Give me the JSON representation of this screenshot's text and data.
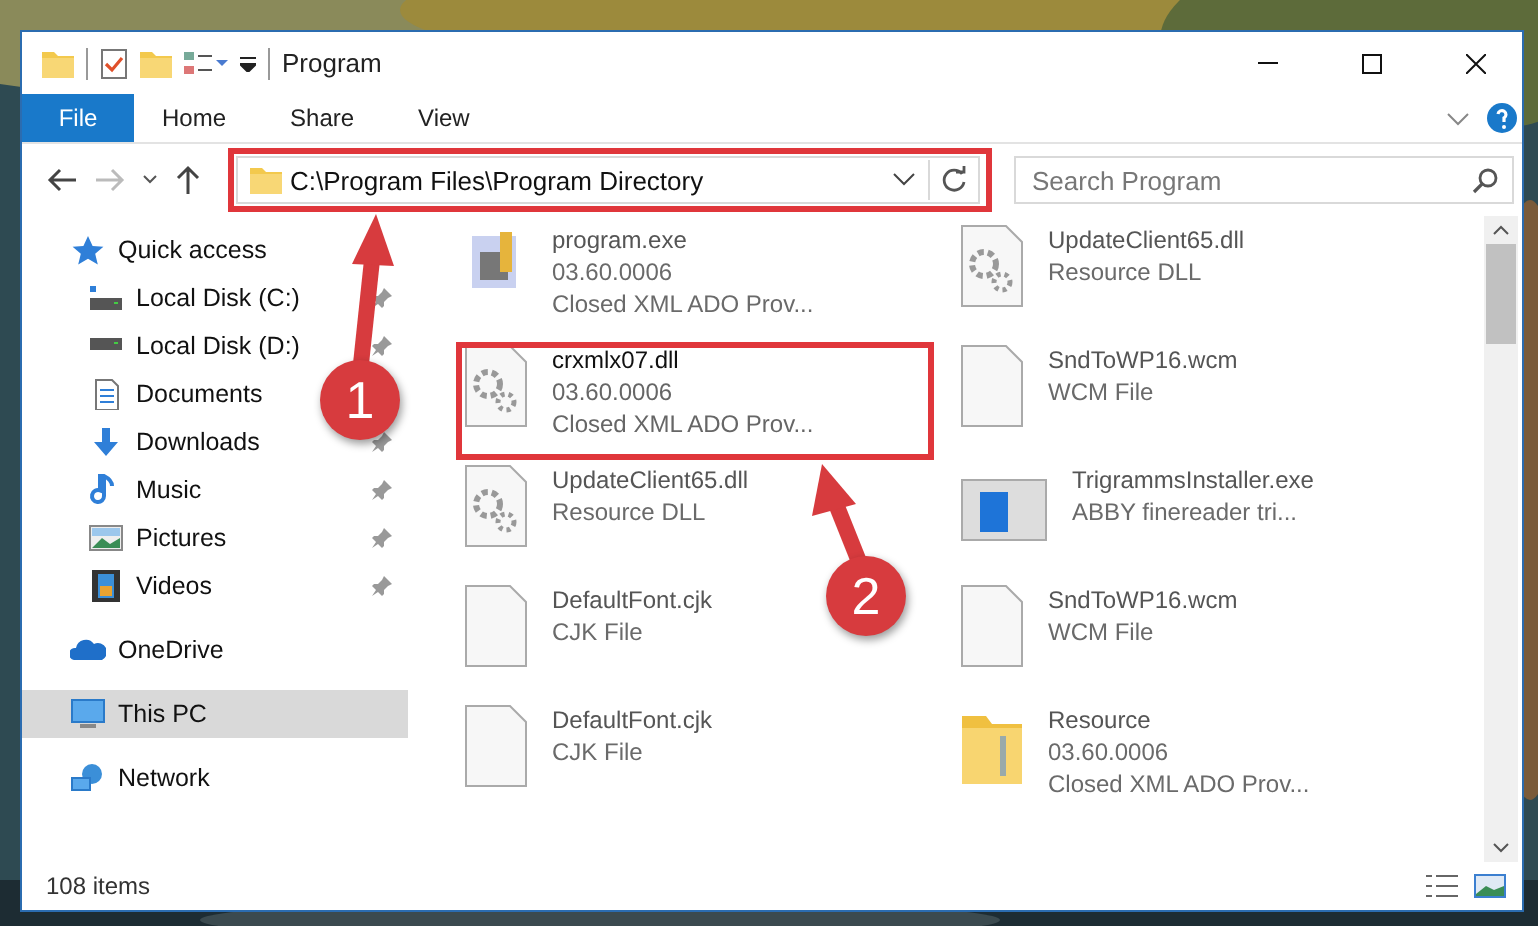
{
  "window": {
    "title": "Program"
  },
  "ribbon_tabs": [
    {
      "label": "File",
      "selected": true
    },
    {
      "label": "Home",
      "selected": false
    },
    {
      "label": "Share",
      "selected": false
    },
    {
      "label": "View",
      "selected": false
    }
  ],
  "address": {
    "value": "C:\\Program Files\\Program Directory"
  },
  "search": {
    "placeholder": "Search Program"
  },
  "sidebar": {
    "items": [
      {
        "label": "Quick access",
        "kind": "star",
        "selected": false,
        "children": [
          {
            "label": "Local Disk (C:)",
            "kind": "disk-c",
            "pinned": true
          },
          {
            "label": "Local Disk (D:)",
            "kind": "disk",
            "pinned": true
          },
          {
            "label": "Documents",
            "kind": "documents",
            "pinned": false
          },
          {
            "label": "Downloads",
            "kind": "downloads",
            "pinned": true
          },
          {
            "label": "Music",
            "kind": "music",
            "pinned": true
          },
          {
            "label": "Pictures",
            "kind": "pictures",
            "pinned": true
          },
          {
            "label": "Videos",
            "kind": "videos",
            "pinned": true
          }
        ]
      },
      {
        "label": "OneDrive",
        "kind": "cloud",
        "selected": false
      },
      {
        "label": "This PC",
        "kind": "pc",
        "selected": true
      },
      {
        "label": "Network",
        "kind": "network",
        "selected": false
      }
    ]
  },
  "files": [
    {
      "name": "program.exe",
      "details": [
        "03.60.0006",
        "Closed XML ADO Prov..."
      ],
      "kind": "exe",
      "dimmed": true
    },
    {
      "name": "UpdateClient65.dll",
      "details": [
        "Resource DLL"
      ],
      "kind": "dll",
      "dimmed": true
    },
    {
      "name": "crxmlx07.dll",
      "details": [
        "03.60.0006",
        "Closed XML ADO Prov..."
      ],
      "kind": "dll",
      "dimmed": false
    },
    {
      "name": "SndToWP16.wcm",
      "details": [
        "WCM File"
      ],
      "kind": "blank",
      "dimmed": true
    },
    {
      "name": "UpdateClient65.dll",
      "details": [
        "Resource DLL"
      ],
      "kind": "dll",
      "dimmed": true
    },
    {
      "name": "TrigrammsInstaller.exe",
      "details": [
        "ABBY finereader tri..."
      ],
      "kind": "installer",
      "dimmed": true
    },
    {
      "name": "DefaultFont.cjk",
      "details": [
        "CJK File"
      ],
      "kind": "blank",
      "dimmed": true
    },
    {
      "name": "SndToWP16.wcm",
      "details": [
        "WCM File"
      ],
      "kind": "blank",
      "dimmed": true
    },
    {
      "name": "DefaultFont.cjk",
      "details": [
        "CJK File"
      ],
      "kind": "blank",
      "dimmed": true
    },
    {
      "name": "Resource",
      "details": [
        "03.60.0006",
        "Closed XML ADO Prov..."
      ],
      "kind": "folder",
      "dimmed": true
    }
  ],
  "status_bar": {
    "count": "108 items"
  },
  "callouts": [
    {
      "number": "1"
    },
    {
      "number": "2"
    }
  ]
}
